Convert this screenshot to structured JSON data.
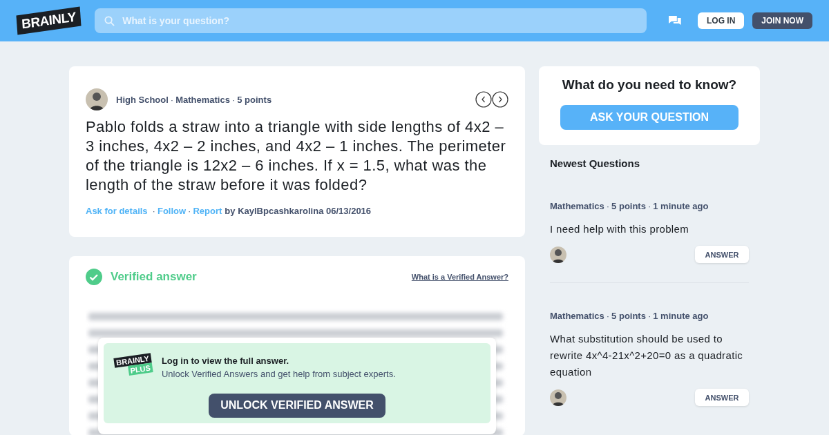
{
  "header": {
    "logo": "BRAINLY",
    "search": {
      "placeholder": "What is your question?"
    },
    "buttons": [
      "LOG IN",
      "JOIN NOW"
    ]
  },
  "separator": "·",
  "question": {
    "meta": [
      "High School",
      "Mathematics",
      "5 points"
    ],
    "text": "Pablo folds a straw into a triangle with side lengths of 4x2 – 3 inches, 4x2 – 2 inches, and 4x2 – 1 inches. The perimeter of the triangle is 12x2 – 6 inches. If x = 1.5, what was the length of the straw before it was folded?",
    "links": [
      "Ask for details",
      "Follow",
      "Report"
    ],
    "author": "by KaylBpcashkarolina 06/13/2016"
  },
  "answer": {
    "title": "Verified answer",
    "help_link": "What is a Verified Answer?",
    "paywall": {
      "logo_top": "BRAINLY",
      "logo_bottom": "PLUS",
      "title": "Log in to view the full answer.",
      "subtitle": "Unlock Verified Answers and get help from subject experts.",
      "button": "UNLOCK VERIFIED ANSWER"
    }
  },
  "ask": {
    "title": "What do you need to know?",
    "button": "ASK YOUR QUESTION"
  },
  "newest": {
    "title": "Newest Questions",
    "items": [
      {
        "meta": [
          "Mathematics",
          "5 points",
          "1 minute ago"
        ],
        "text": "I need help with this problem",
        "button": "ANSWER"
      },
      {
        "meta": [
          "Mathematics",
          "5 points",
          "1 minute ago"
        ],
        "text": "What substitution should be used to rewrite 4x^4-21x^2+20=0 as a quadratic equation",
        "button": "ANSWER"
      }
    ]
  }
}
